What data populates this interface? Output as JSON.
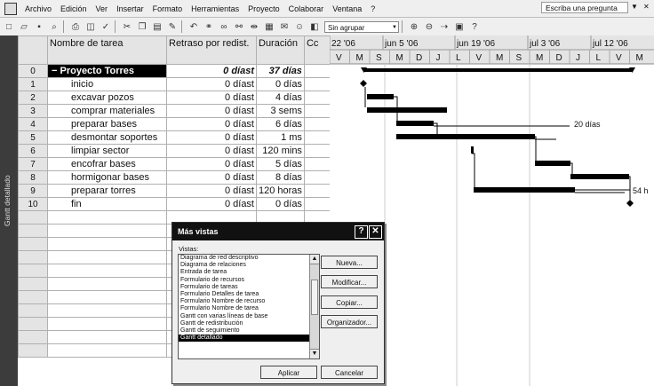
{
  "menu": {
    "items": [
      "Archivo",
      "Edición",
      "Ver",
      "Insertar",
      "Formato",
      "Herramientas",
      "Proyecto",
      "Colaborar",
      "Ventana",
      "?"
    ],
    "ask_placeholder": "Escriba una pregunta"
  },
  "toolbar": {
    "icons": [
      "new-icon",
      "open-icon",
      "save-icon",
      "search-icon",
      "print-icon",
      "print-preview-icon",
      "spelling-icon",
      "cut-icon",
      "copy-icon",
      "paste-icon",
      "format-painter-icon",
      "undo-icon",
      "hyperlink-icon",
      "link-tasks-icon",
      "unlink-tasks-icon",
      "split-task-icon",
      "task-info-icon",
      "task-notes-icon",
      "assign-resources-icon",
      "publish-icon"
    ],
    "group_value": "Sin agrupar"
  },
  "sidebar_label": "Gantt detallado",
  "columns": {
    "id": "",
    "name": "Nombre de tarea",
    "slack": "Retraso por redist.",
    "duration": "Duración",
    "extra": "Cc"
  },
  "tasks": [
    {
      "id": "0",
      "name": "Proyecto Torres",
      "slack": "0 díast",
      "duration": "37 días",
      "summary": true
    },
    {
      "id": "1",
      "name": "inicio",
      "slack": "0 díast",
      "duration": "0 días"
    },
    {
      "id": "2",
      "name": "excavar pozos",
      "slack": "0 díast",
      "duration": "4 días"
    },
    {
      "id": "3",
      "name": "comprar materiales",
      "slack": "0 díast",
      "duration": "3 sems"
    },
    {
      "id": "4",
      "name": "preparar bases",
      "slack": "0 díast",
      "duration": "6 días"
    },
    {
      "id": "5",
      "name": "desmontar soportes",
      "slack": "0 díast",
      "duration": "1 ms"
    },
    {
      "id": "6",
      "name": "limpiar sector",
      "slack": "0 díast",
      "duration": "120 mins"
    },
    {
      "id": "7",
      "name": "encofrar bases",
      "slack": "0 díast",
      "duration": "5 días"
    },
    {
      "id": "8",
      "name": "hormigonar bases",
      "slack": "0 díast",
      "duration": "8 días"
    },
    {
      "id": "9",
      "name": "preparar torres",
      "slack": "0 díast",
      "duration": "120 horas"
    },
    {
      "id": "10",
      "name": "fin",
      "slack": "0 díast",
      "duration": "0 días"
    }
  ],
  "empty_rows": 11,
  "gantt": {
    "weeks": [
      "22 '06",
      "jun 5 '06",
      "jun 19 '06",
      "jul 3 '06",
      "jul 12 '06"
    ],
    "days": [
      "V",
      "M",
      "S",
      "M",
      "D",
      "J",
      "L",
      "V",
      "M",
      "S",
      "M",
      "D",
      "J",
      "L",
      "V",
      "M"
    ],
    "labels": {
      "slack_4": "20 días",
      "slack_9": "54 h"
    }
  },
  "dialog": {
    "title": "Más vistas",
    "views_label": "Vistas:",
    "views": [
      "Diagrama de red descriptivo",
      "Diagrama de relaciones",
      "Entrada de tarea",
      "Formulario de recursos",
      "Formulario de tareas",
      "Formulario Detalles de tarea",
      "Formulario Nombre de recurso",
      "Formulario Nombre de tarea",
      "Gantt con varias líneas de base",
      "Gantt de redistribución",
      "Gantt de seguimiento",
      "Gantt detallado"
    ],
    "selected_view": "Gantt detallado",
    "buttons": {
      "new": "Nueva...",
      "modify": "Modificar...",
      "copy": "Copiar...",
      "organizer": "Organizador...",
      "apply": "Aplicar",
      "cancel": "Cancelar"
    }
  }
}
